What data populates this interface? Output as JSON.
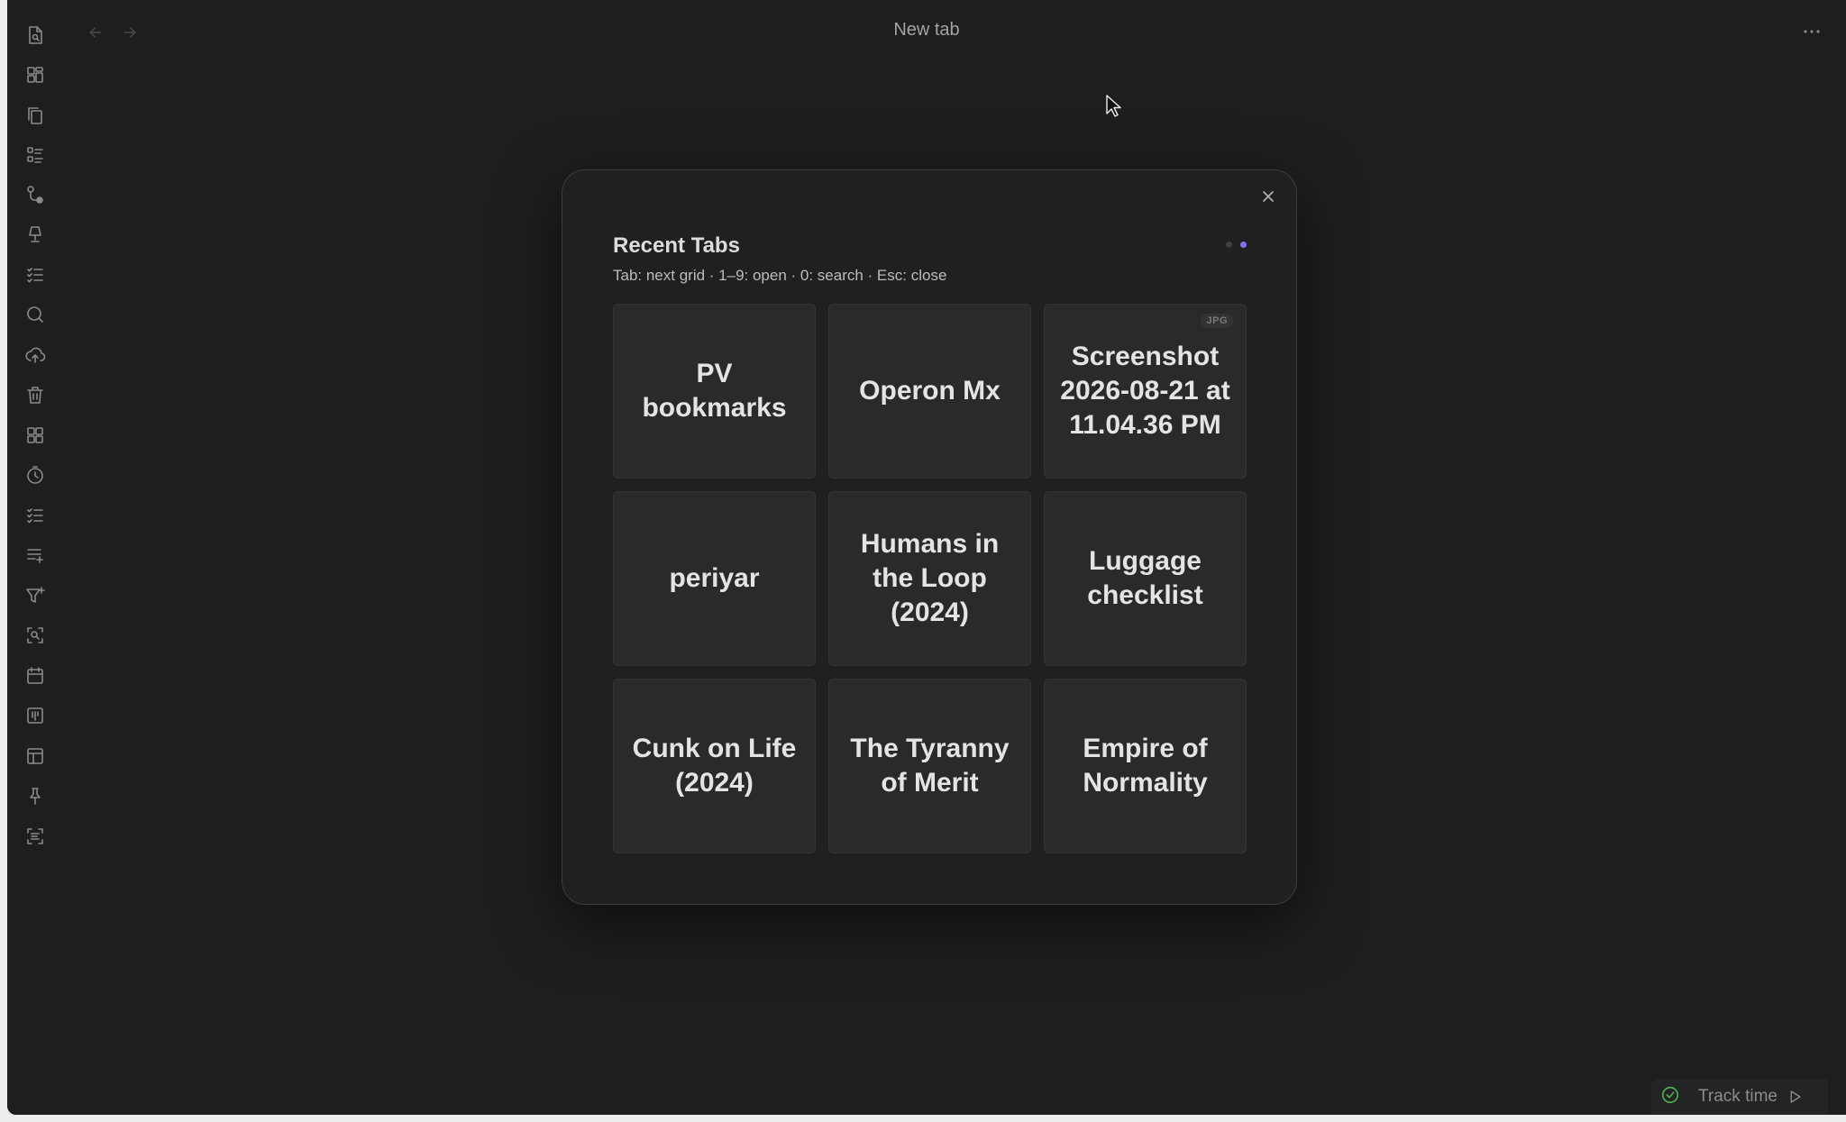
{
  "titlebar": {
    "tab_title": "New tab"
  },
  "ribbon": {
    "icons": [
      "file-search-icon",
      "dashboard-icon",
      "copy-icon",
      "list-icon",
      "graph-nodes-icon",
      "lamp-icon",
      "checklist-icon",
      "search-icon",
      "cloud-upload-icon",
      "trash-icon",
      "grid-icon",
      "clock-icon",
      "checklist-icon",
      "list-add-icon",
      "filter-add-icon",
      "scan-search-icon",
      "calendar-icon",
      "kanban-icon",
      "table-icon",
      "pin-icon",
      "scan-text-icon"
    ]
  },
  "modal": {
    "title": "Recent Tabs",
    "hint": "Tab: next grid · 1–9: open · 0: search · Esc: close",
    "page_count": 2,
    "active_page": 2,
    "cards": [
      {
        "label": "PV bookmarks",
        "badge": ""
      },
      {
        "label": "Operon Mx",
        "badge": ""
      },
      {
        "label": "Screenshot 2026-08-21 at 11.04.36 PM",
        "badge": "JPG"
      },
      {
        "label": "periyar",
        "badge": ""
      },
      {
        "label": "Humans in the Loop (2024)",
        "badge": ""
      },
      {
        "label": "Luggage checklist",
        "badge": ""
      },
      {
        "label": "Cunk on Life (2024)",
        "badge": ""
      },
      {
        "label": "The Tyranny of Merit",
        "badge": ""
      },
      {
        "label": "Empire of Normality",
        "badge": ""
      }
    ]
  },
  "statusbar": {
    "track_time": "Track time"
  },
  "colors": {
    "accent": "#8a6cf0",
    "success": "#4caf50",
    "background": "#1e1e1e"
  }
}
